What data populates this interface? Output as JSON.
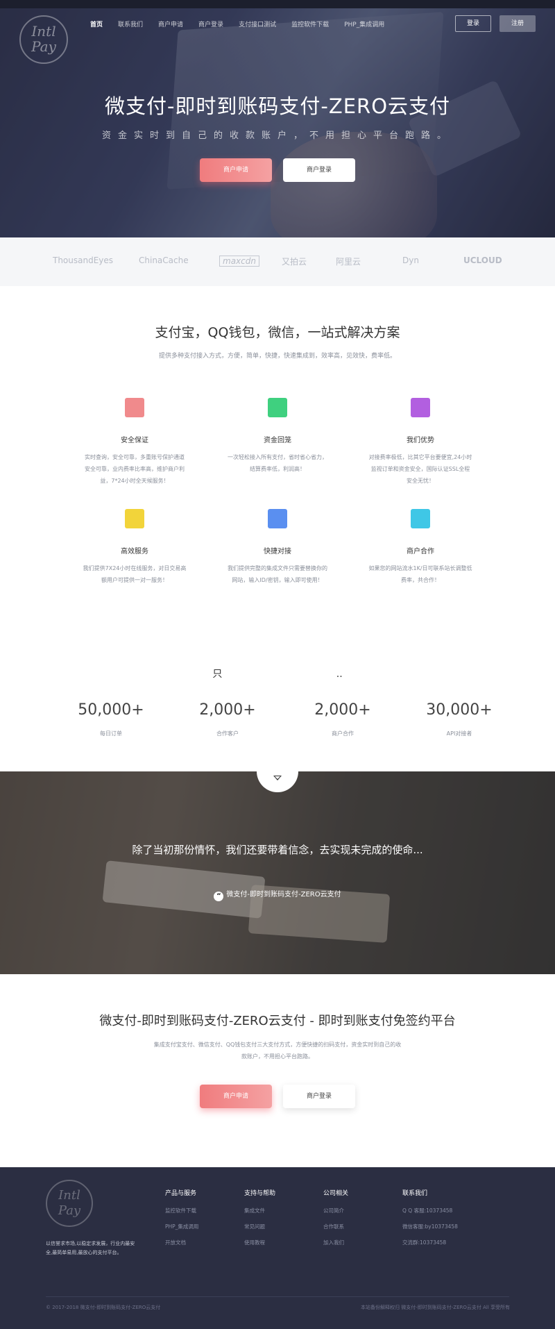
{
  "header": {
    "logo_text": "Intl\nPay",
    "nav": [
      "首页",
      "联系我们",
      "商户申请",
      "商户登录",
      "支付接口测试",
      "监控软件下载",
      "PHP_集成调用"
    ],
    "login_label": "登录",
    "register_label": "注册"
  },
  "hero": {
    "title": "微支付-即时到账码支付-ZERO云支付",
    "subtitle": "资金实时到自己的收款账户，不用担心平台跑路。",
    "apply_label": "商户申请",
    "login_label": "商户登录"
  },
  "partners": [
    "ThousandEyes",
    "ChinaCache",
    "maxcdn",
    "又拍云",
    "阿里云",
    "Dyn",
    "UCLOUD"
  ],
  "solution": {
    "title": "支付宝，QQ钱包，微信，一站式解决方案",
    "subtitle": "提供多种支付接入方式，方便，简单，快捷，快速集成到，效率高，见效快，费率低。",
    "features": [
      {
        "title": "安全保证",
        "desc": "实时查询，安全可靠，多重账号保护通道安全可靠，业内费率比率高，维护商户利益，7*24小时全天候服务！",
        "color": "#f08a8c",
        "icon": "list-icon"
      },
      {
        "title": "资金回笼",
        "desc": "一次轻松接入所有支付，省时省心省力，结算费率低，利润高！",
        "color": "#3fd07f",
        "icon": "code-icon"
      },
      {
        "title": "我们优势",
        "desc": "对接费率极低，比其它平台要便宜,24小时监视订单和资金安全，国际认证SSL全程安全无忧！",
        "color": "#b25fe0",
        "icon": "grid-icon"
      },
      {
        "title": "高效服务",
        "desc": "我们提供7X24小时在线服务，对日交易高额用户可提供一对一服务！",
        "color": "#f2d43a",
        "icon": "chart-icon"
      },
      {
        "title": "快捷对接",
        "desc": "我们提供完整的集成文件只需要替换你的网站，输入ID/密钥，输入即可使用！",
        "color": "#5a8ff0",
        "icon": "pen-icon"
      },
      {
        "title": "商户合作",
        "desc": "如果您的网站流水1K/日可联系站长调整低费率，共合作！",
        "color": "#3fc7e6",
        "icon": "puzzle-icon"
      }
    ]
  },
  "stats": {
    "title": "只",
    "dots": "..",
    "items": [
      {
        "value": "50,000+",
        "label": "每日订单"
      },
      {
        "value": "2,000+",
        "label": "合作客户"
      },
      {
        "value": "2,000+",
        "label": "商户合作"
      },
      {
        "value": "30,000+",
        "label": "API对接者"
      }
    ]
  },
  "quote": {
    "text": "除了当初那份情怀，我们还要带着信念，去实现未完成的使命...",
    "source": "微支付-即时到账码支付-ZERO云支付",
    "quote_mark": "“"
  },
  "platform": {
    "title": "微支付-即时到账码支付-ZERO云支付 - 即时到账支付免签约平台",
    "desc": "集成支付宝支付、微信支付、QQ钱包支付三大支付方式，方便快捷的扫码支付，资金实时到自己的收款账户，不用担心平台跑路。",
    "apply_label": "商户申请",
    "login_label": "商户登录"
  },
  "footer": {
    "logo_text": "Intl\nPay",
    "about": "以信誉求市场,以稳定求发展，行业内最安全,最简单易用,最放心的支付平台。",
    "columns": [
      {
        "heading": "产品与服务",
        "items": [
          "监控软件下载",
          "PHP_集成调用",
          "开放文档"
        ]
      },
      {
        "heading": "支持与帮助",
        "items": [
          "集成文件",
          "常见问题",
          "使用教程"
        ]
      },
      {
        "heading": "公司相关",
        "items": [
          "公司简介",
          "合作联系",
          "加入我们"
        ]
      },
      {
        "heading": "联系我们",
        "items": [
          "Q Q 客服:10373458",
          "微信客服:by10373458",
          "交流群:10373458"
        ]
      }
    ],
    "copyright": "© 2017-2018 微支付-即时到账码支付-ZERO云支付",
    "record": "本站备份解释权归 微支付-即时到账码支付-ZERO云支付 All 享受所有"
  }
}
